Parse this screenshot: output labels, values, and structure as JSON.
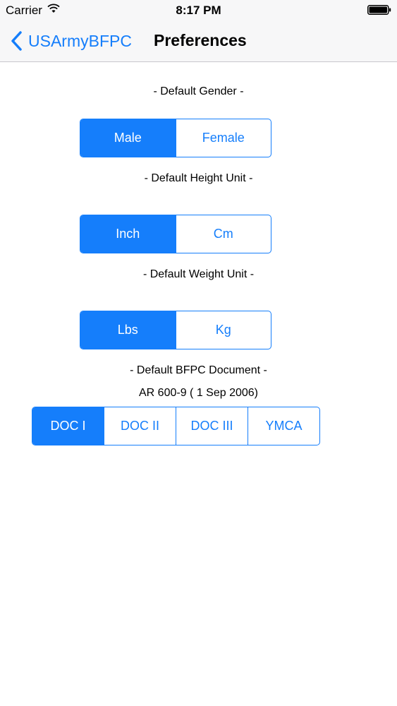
{
  "status_bar": {
    "carrier": "Carrier",
    "time": "8:17 PM",
    "wifi_icon": "wifi-icon",
    "battery_icon": "battery-icon"
  },
  "nav": {
    "back_label": "USArmyBFPC",
    "back_icon": "chevron-left-icon",
    "title": "Preferences"
  },
  "colors": {
    "accent": "#157efb",
    "bar_background": "#f7f7f8"
  },
  "gender": {
    "label": "- Default Gender -",
    "options": [
      "Male",
      "Female"
    ],
    "selected": "Male"
  },
  "height": {
    "label": "- Default Height Unit -",
    "options": [
      "Inch",
      "Cm"
    ],
    "selected": "Inch"
  },
  "weight": {
    "label": "- Default Weight Unit -",
    "options": [
      "Lbs",
      "Kg"
    ],
    "selected": "Lbs"
  },
  "document": {
    "label": "- Default BFPC Document -",
    "current_doc": "AR 600-9 ( 1 Sep 2006)",
    "options": [
      "DOC I",
      "DOC II",
      "DOC III",
      "YMCA"
    ],
    "selected": "DOC I"
  }
}
